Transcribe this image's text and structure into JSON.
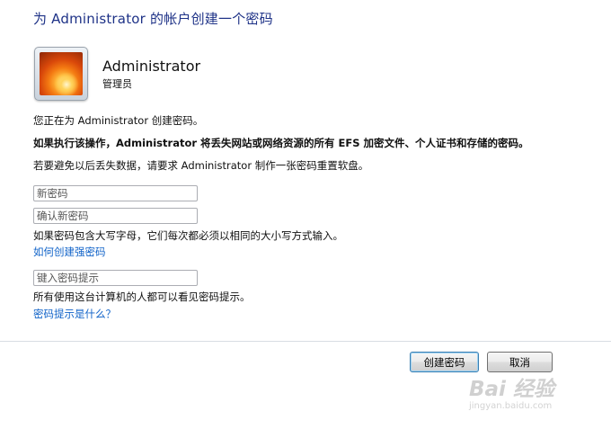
{
  "dialog": {
    "title": "为 Administrator 的帐户创建一个密码"
  },
  "user": {
    "name": "Administrator",
    "role": "管理员",
    "avatar_icon": "flower-avatar-icon"
  },
  "messages": {
    "creating": "您正在为 Administrator 创建密码。",
    "warning": "如果执行该操作，Administrator 将丢失网站或网络资源的所有 EFS 加密文件、个人证书和存储的密码。",
    "reset_disk": "若要避免以后丢失数据，请要求 Administrator 制作一张密码重置软盘。"
  },
  "fields": {
    "new_password_placeholder": "新密码",
    "confirm_password_placeholder": "确认新密码",
    "hint_placeholder": "键入密码提示"
  },
  "notes": {
    "case_sensitive": "如果密码包含大写字母，它们每次都必须以相同的大小写方式输入。",
    "hint_visible": "所有使用这台计算机的人都可以看见密码提示。"
  },
  "links": {
    "strong_password": "如何创建强密码",
    "what_is_hint": "密码提示是什么？"
  },
  "buttons": {
    "create": "创建密码",
    "cancel": "取消"
  },
  "watermark": {
    "text": "Bai 经验",
    "sub": "jingyan.baidu.com"
  }
}
